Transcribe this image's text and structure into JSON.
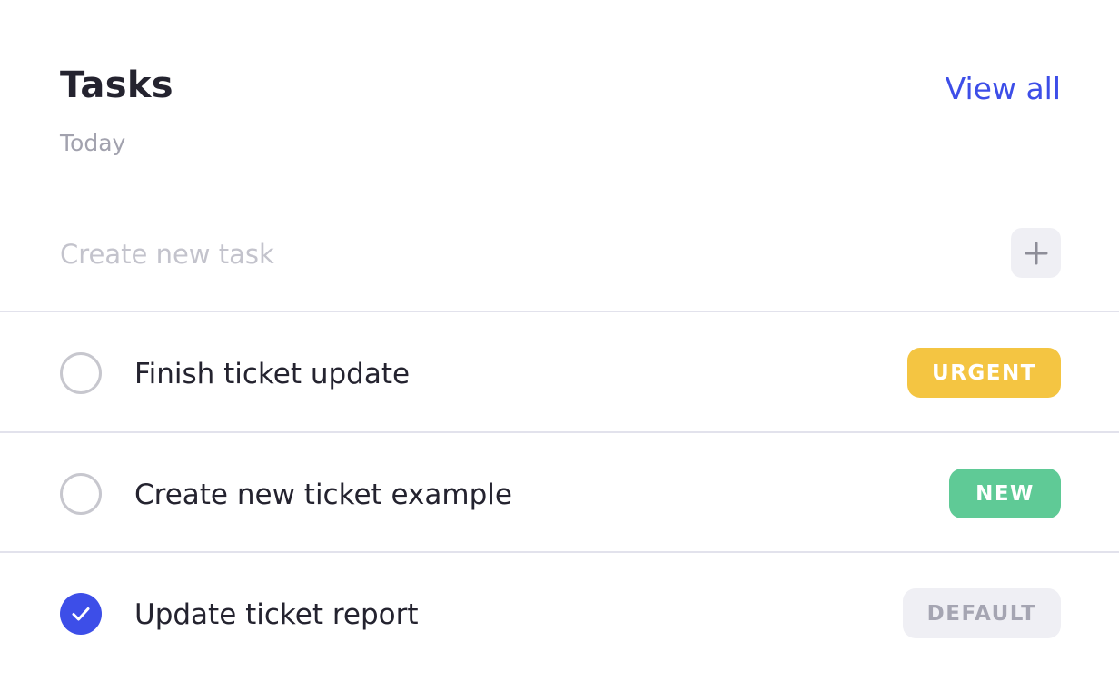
{
  "header": {
    "title": "Tasks",
    "subtitle": "Today",
    "view_all_label": "View all"
  },
  "new_task": {
    "placeholder": "Create new task",
    "value": "",
    "add_icon": "plus-icon"
  },
  "tasks": [
    {
      "label": "Finish ticket update",
      "checked": false,
      "badge": {
        "text": "URGENT",
        "bg": "#f4c542",
        "fg": "#ffffff"
      }
    },
    {
      "label": "Create new ticket example",
      "checked": false,
      "badge": {
        "text": "NEW",
        "bg": "#5fca96",
        "fg": "#ffffff"
      }
    },
    {
      "label": "Update ticket report",
      "checked": true,
      "badge": {
        "text": "DEFAULT",
        "bg": "#efeff4",
        "fg": "#a5a5b2"
      }
    }
  ],
  "colors": {
    "accent": "#3d4ee8",
    "title": "#24232f",
    "muted": "#a2a2ae",
    "divider": "#e2e2ec"
  }
}
